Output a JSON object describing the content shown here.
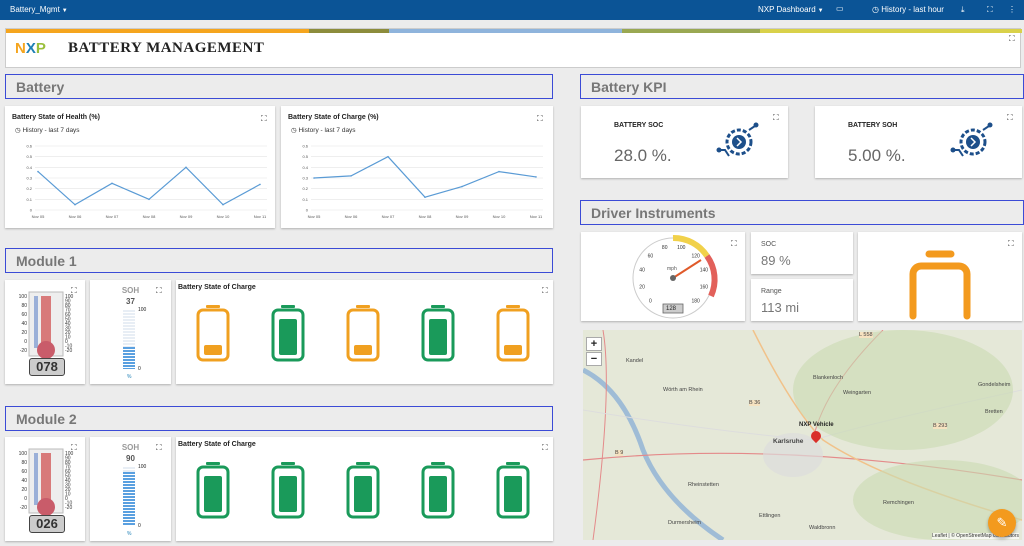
{
  "topbar": {
    "app": "Battery_Mgmt",
    "dashboard": "NXP Dashboard",
    "history": "History - last hour"
  },
  "banner": {
    "logo": "NXP",
    "title": "BATTERY MANAGEMENT"
  },
  "sections": {
    "battery": "Battery",
    "kpi": "Battery KPI",
    "driver": "Driver Instruments",
    "module1": "Module 1",
    "module2": "Module 2"
  },
  "soh_chart": {
    "title": "Battery State of Health (%)",
    "subtitle": "History - last 7 days"
  },
  "soc_chart": {
    "title": "Battery State of Charge (%)",
    "subtitle": "History - last 7 days"
  },
  "chart_data": [
    {
      "type": "line",
      "title": "Battery State of Health (%)",
      "categories": [
        "Nov 05",
        "Nov 06",
        "Nov 07",
        "Nov 08",
        "Nov 09",
        "Nov 10",
        "Nov 11"
      ],
      "yticks": [
        "0.6",
        "0.5",
        "0.4",
        "0.3",
        "0.2",
        "0.1",
        "0"
      ],
      "ylim": [
        0,
        0.6
      ],
      "values": [
        0.36,
        0.05,
        0.25,
        0.1,
        0.4,
        0.05,
        0.24
      ]
    },
    {
      "type": "line",
      "title": "Battery State of Charge (%)",
      "categories": [
        "Nov 05",
        "Nov 06",
        "Nov 07",
        "Nov 08",
        "Nov 09",
        "Nov 10",
        "Nov 11"
      ],
      "yticks": [
        "0.6",
        "0.5",
        "0.4",
        "0.3",
        "0.2",
        "0.1",
        "0"
      ],
      "ylim": [
        0,
        0.6
      ],
      "values": [
        0.3,
        0.32,
        0.5,
        0.12,
        0.22,
        0.36,
        0.31
      ]
    }
  ],
  "kpi": {
    "soc_label": "BATTERY SOC",
    "soc_value": "28.0 %.",
    "soh_label": "BATTERY SOH",
    "soh_value": "5.00 %."
  },
  "instruments": {
    "soc_label": "SOC",
    "soc_value": "89 %",
    "range_label": "Range",
    "range_value": "113 mi",
    "speed_unit": "mph",
    "speed_readout": "128",
    "gauge_ticks": [
      "0",
      "20",
      "40",
      "60",
      "80",
      "100",
      "120",
      "140",
      "160",
      "180"
    ]
  },
  "module1": {
    "temp_display": "078",
    "soh_label": "SOH",
    "soh_value": "37",
    "soh_max": "100",
    "soh_min": "0",
    "soh_unit": "%",
    "soh_fill": 0.37,
    "soc_title": "Battery State of Charge",
    "therm_ticks": [
      "100",
      "80",
      "60",
      "40",
      "20",
      "0",
      "-20"
    ],
    "therm_ticks_r": [
      "100",
      "90",
      "80",
      "70",
      "60",
      "50",
      "40",
      "30",
      "20",
      "10",
      "0",
      "-10",
      "-20"
    ],
    "batteries": [
      {
        "color": "#f0a020",
        "level": 0.25
      },
      {
        "color": "#1a9a5a",
        "level": 0.9
      },
      {
        "color": "#f0a020",
        "level": 0.25
      },
      {
        "color": "#1a9a5a",
        "level": 0.9
      },
      {
        "color": "#f0a020",
        "level": 0.25
      }
    ]
  },
  "module2": {
    "temp_display": "026",
    "soh_label": "SOH",
    "soh_value": "90",
    "soh_max": "100",
    "soh_min": "0",
    "soh_unit": "%",
    "soh_fill": 0.9,
    "soc_title": "Battery State of Charge",
    "batteries": [
      {
        "color": "#1a9a5a",
        "level": 0.9
      },
      {
        "color": "#1a9a5a",
        "level": 0.9
      },
      {
        "color": "#1a9a5a",
        "level": 0.9
      },
      {
        "color": "#1a9a5a",
        "level": 0.9
      },
      {
        "color": "#1a9a5a",
        "level": 0.9
      }
    ]
  },
  "map": {
    "marker": "NXP Vehicle",
    "city": "Karlsruhe",
    "places": [
      "Kandel",
      "Wörth am Rhein",
      "Rheinstetten",
      "Durmersheim",
      "Ettlingen",
      "Waldbronn",
      "Blankenloch",
      "Weingarten",
      "Gondelsheim",
      "Bretten",
      "Remchingen"
    ],
    "roads": [
      "B 36",
      "B 9",
      "L 558",
      "B 293"
    ],
    "attribution": "Leaflet | © OpenStreetMap contributors",
    "zoom_in": "+",
    "zoom_out": "−"
  },
  "colors": {
    "topbar": "#0b5496",
    "accent": "#f39a1e",
    "green": "#1a9a5a",
    "line": "#5a9bd5"
  }
}
